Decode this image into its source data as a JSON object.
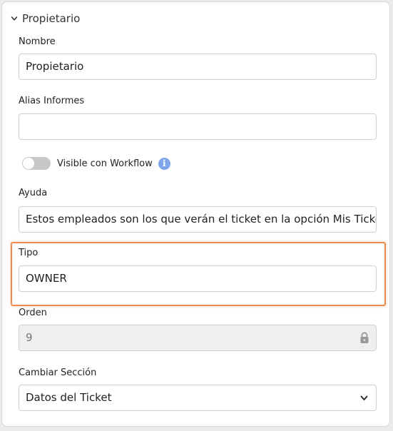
{
  "section": {
    "title": "Propietario",
    "toggle_icon": "chevron-down-icon"
  },
  "fields": {
    "nombre": {
      "label": "Nombre",
      "value": "Propietario"
    },
    "alias": {
      "label": "Alias Informes",
      "value": ""
    },
    "visible_workflow": {
      "label": "Visible con Workflow",
      "enabled": false,
      "info_icon": "info-icon"
    },
    "ayuda": {
      "label": "Ayuda",
      "value": "Estos empleados son los que verán el ticket en la opción Mis Tickets"
    },
    "tipo": {
      "label": "Tipo",
      "value": "OWNER",
      "highlighted": true,
      "highlight_color": "#f08a52"
    },
    "orden": {
      "label": "Orden",
      "value": "9",
      "disabled": true,
      "lock_icon": "lock-icon"
    },
    "cambiar_seccion": {
      "label": "Cambiar Sección",
      "value": "Datos del Ticket",
      "dropdown_icon": "chevron-down-icon"
    }
  },
  "colors": {
    "toggle_off": "#c8c8c8",
    "info": "#7fa6ea",
    "disabled_bg": "#efefef"
  }
}
